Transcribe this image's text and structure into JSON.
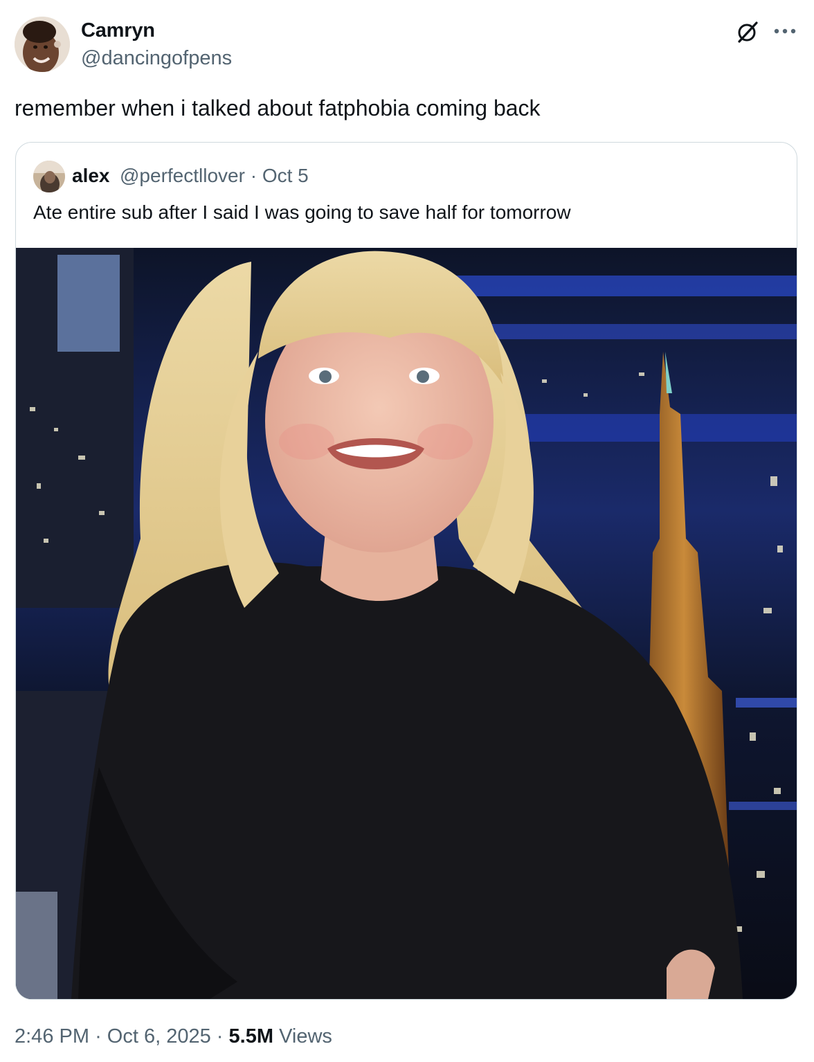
{
  "tweet": {
    "author": {
      "display_name": "Camryn",
      "handle": "@dancingofpens",
      "avatar": "user-avatar-photo"
    },
    "text": "remember when i talked about fatphobia coming back",
    "quoted": {
      "author": {
        "display_name": "alex",
        "handle": "@perfectllover",
        "avatar": "user-avatar-photo"
      },
      "separator": "·",
      "date": "Oct 5",
      "text": "Ate entire sub after I said I was going to save half for tomorrow",
      "media": "photo of a smiling blonde woman in a black top on a talk-show set with a night city backdrop"
    },
    "footer": {
      "time": "2:46 PM",
      "separator": "·",
      "date": "Oct 6, 2025",
      "views_count": "5.5M",
      "views_label": "Views"
    },
    "icons": {
      "grok": "grok-icon",
      "more": "more-options-icon"
    },
    "colors": {
      "text_primary": "#0f1419",
      "text_secondary": "#536471",
      "border": "#cfd9de"
    }
  }
}
